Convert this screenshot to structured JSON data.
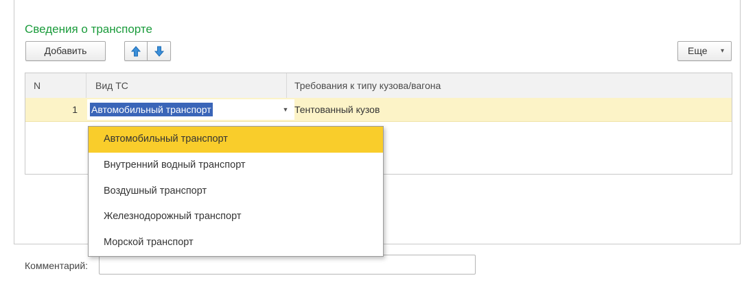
{
  "section": {
    "title": "Сведения о транспорте"
  },
  "toolbar": {
    "add_label": "Добавить",
    "up_icon": "arrow-up-icon",
    "down_icon": "arrow-down-icon",
    "more_label": "Еще",
    "more_caret": "▾"
  },
  "table": {
    "headers": {
      "n": "N",
      "vid": "Вид ТС",
      "req": "Требования к типу кузова/вагона"
    },
    "rows": [
      {
        "n": "1",
        "vid": "Автомобильный транспорт",
        "req": "Тентованный кузов"
      }
    ]
  },
  "dropdown": {
    "items": [
      "Автомобильный транспорт",
      "Внутренний водный транспорт",
      "Воздушный транспорт",
      "Железнодорожный транспорт",
      "Морской транспорт"
    ],
    "selected_index": 0
  },
  "comment": {
    "label": "Комментарий:",
    "value": ""
  },
  "colors": {
    "title_green": "#1a9b3b",
    "row_highlight": "#fcf3c7",
    "selection_blue": "#3a65b8",
    "dropdown_active": "#f9cd2b",
    "arrow_blue": "#3b8fd9"
  }
}
